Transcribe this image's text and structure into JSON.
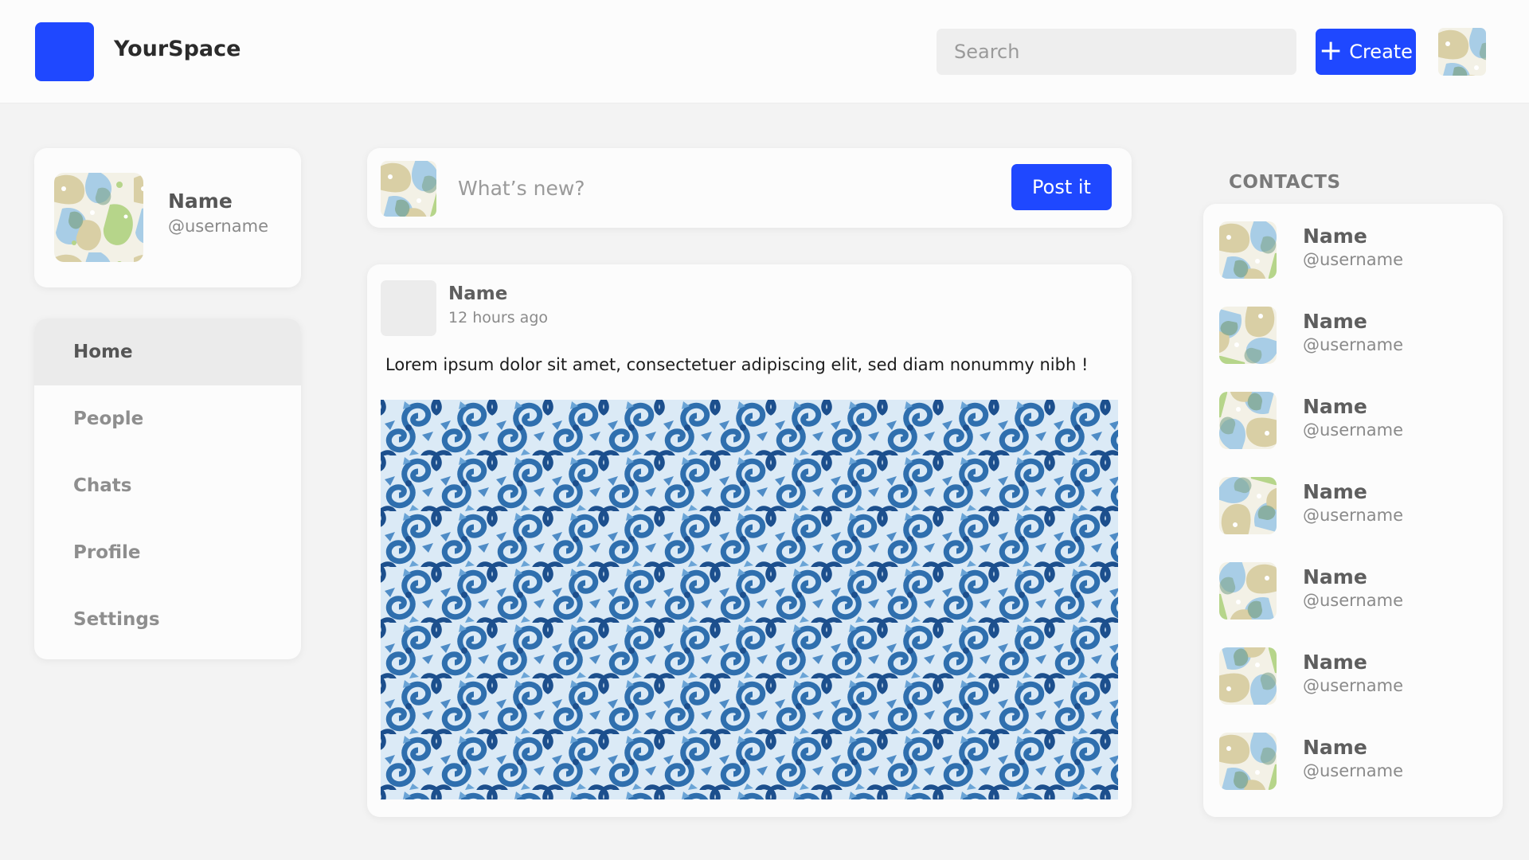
{
  "app": {
    "brand": "YourSpace",
    "accent_color": "#1f48ff"
  },
  "header": {
    "search_placeholder": "Search",
    "create_label": "Create",
    "create_icon": "plus-icon"
  },
  "profile": {
    "name": "Name",
    "username": "@username"
  },
  "nav": {
    "items": [
      {
        "label": "Home",
        "active": true
      },
      {
        "label": "People",
        "active": false
      },
      {
        "label": "Chats",
        "active": false
      },
      {
        "label": "Profile",
        "active": false
      },
      {
        "label": "Settings",
        "active": false
      }
    ]
  },
  "composer": {
    "placeholder": "What’s new?",
    "post_label": "Post it"
  },
  "post": {
    "author": "Name",
    "time": "12 hours ago",
    "text": "Lorem ipsum dolor sit amet, consectetuer adipiscing elit, sed diam nonummy nibh !"
  },
  "contacts": {
    "title": "CONTACTS",
    "items": [
      {
        "name": "Name",
        "username": "@username"
      },
      {
        "name": "Name",
        "username": "@username"
      },
      {
        "name": "Name",
        "username": "@username"
      },
      {
        "name": "Name",
        "username": "@username"
      },
      {
        "name": "Name",
        "username": "@username"
      },
      {
        "name": "Name",
        "username": "@username"
      },
      {
        "name": "Name",
        "username": "@username"
      }
    ]
  }
}
